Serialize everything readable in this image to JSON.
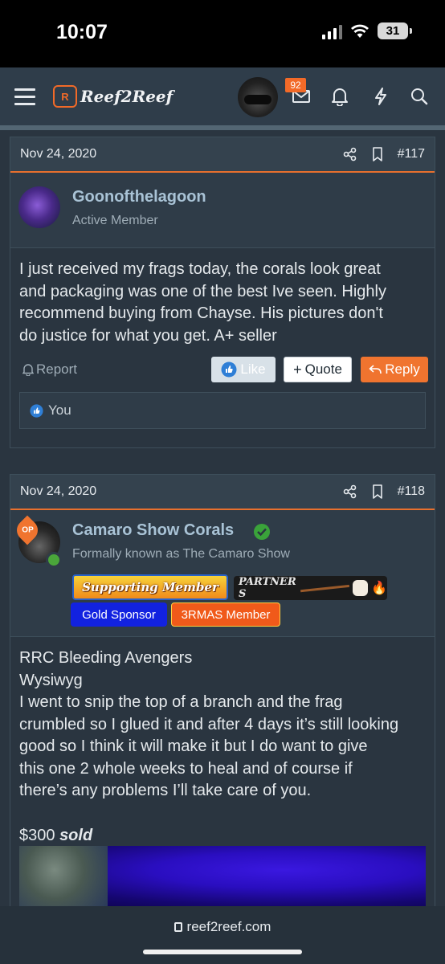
{
  "status": {
    "time": "10:07",
    "battery": "31"
  },
  "header": {
    "logo_text": "Reef2Reef",
    "notifications_count": "92"
  },
  "posts": [
    {
      "date": "Nov 24, 2020",
      "number": "#117",
      "author": "Goonofthelagoon",
      "user_title": "Active Member",
      "body": [
        "I just received my frags today, the corals look great",
        "and packaging was one of the best Ive seen. Highly",
        "recommend buying from Chayse. His pictures don't",
        "do justice for what you get. A+ seller"
      ],
      "actions": {
        "report": "Report",
        "like": "Like",
        "quote": "Quote",
        "reply": "Reply"
      },
      "reactions": "You"
    },
    {
      "date": "Nov 24, 2020",
      "number": "#118",
      "op_badge": "OP",
      "author": "Camaro Show Corals",
      "user_title": "Formally known as The Camaro Show",
      "banners": {
        "supporting": "Supporting Member",
        "partner": "PARTNER S"
      },
      "tags": [
        "Gold Sponsor",
        "3RMAS Member"
      ],
      "body": [
        "RRC Bleeding Avengers",
        "Wysiwyg",
        "I went to snip the top of a branch and the frag",
        "crumbled so I glued it and after 4 days it’s still looking",
        "good so I think it will make it but I do want to give",
        "this one 2 whole weeks to heal and of course if",
        "there’s any problems I’ll take care of you."
      ],
      "price": "$300",
      "price_status": "sold"
    }
  ],
  "browser": {
    "url": "reef2reef.com"
  },
  "colors": {
    "accent": "#e8702e",
    "background": "#2a3540",
    "link": "#a9c3d6"
  }
}
